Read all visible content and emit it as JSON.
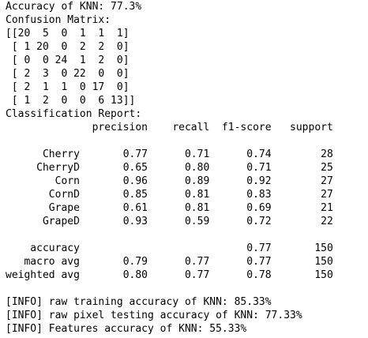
{
  "output": {
    "lines": [
      "Accuracy of KNN: 77.3%",
      "Confusion Matrix:",
      "[[20  5  0  1  1  1]",
      " [ 1 20  0  2  2  0]",
      " [ 0  0 24  1  2  0]",
      " [ 2  3  0 22  0  0]",
      " [ 2  1  1  0 17  0]",
      " [ 1  2  0  0  6 13]]",
      "Classification Report:",
      "              precision    recall  f1-score   support",
      "",
      "      Cherry       0.77      0.71      0.74        28",
      "     CherryD       0.65      0.80      0.71        25",
      "        Corn       0.96      0.89      0.92        27",
      "       CornD       0.85      0.81      0.83        27",
      "       Grape       0.61      0.81      0.69        21",
      "      GrapeD       0.93      0.59      0.72        22",
      "",
      "    accuracy                           0.77       150",
      "   macro avg       0.79      0.77      0.77       150",
      "weighted avg       0.80      0.77      0.78       150",
      "",
      "[INFO] raw training accuracy of KNN: 85.33%",
      "[INFO] raw pixel testing accuracy of KNN: 77.33%",
      "[INFO] Features accuracy of KNN: 55.33%"
    ]
  }
}
